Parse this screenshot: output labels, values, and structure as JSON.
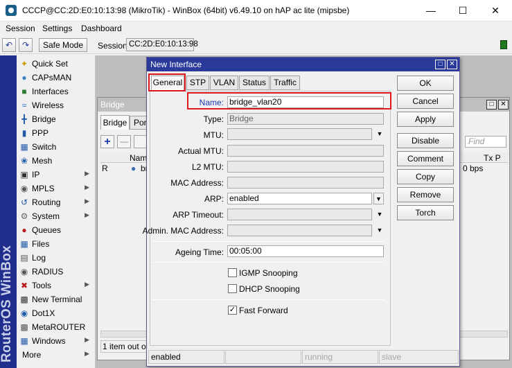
{
  "window": {
    "title": "CCCP@CC:2D:E0:10:13:98 (MikroTik) - WinBox (64bit) v6.49.10 on hAP ac lite (mipsbe)"
  },
  "menu": [
    "Session",
    "Settings",
    "Dashboard"
  ],
  "toolbar": {
    "undo_icon": "undo-arrow",
    "redo_icon": "redo-arrow",
    "safe_mode": "Safe Mode",
    "session_label": "Session:",
    "session_value": "CC:2D:E0:10:13:98",
    "status_indicator_color": "#1f7a1f"
  },
  "brand_text": "RouterOS WinBox",
  "sidebar": {
    "items": [
      {
        "label": "Quick Set",
        "icon": "wand-icon",
        "submenu": false
      },
      {
        "label": "CAPsMAN",
        "icon": "capsman-icon",
        "submenu": false
      },
      {
        "label": "Interfaces",
        "icon": "interfaces-icon",
        "submenu": false
      },
      {
        "label": "Wireless",
        "icon": "wireless-icon",
        "submenu": false
      },
      {
        "label": "Bridge",
        "icon": "bridge-icon",
        "submenu": false
      },
      {
        "label": "PPP",
        "icon": "ppp-icon",
        "submenu": false
      },
      {
        "label": "Switch",
        "icon": "switch-icon",
        "submenu": false
      },
      {
        "label": "Mesh",
        "icon": "mesh-icon",
        "submenu": false
      },
      {
        "label": "IP",
        "icon": "ip-icon",
        "submenu": true
      },
      {
        "label": "MPLS",
        "icon": "mpls-icon",
        "submenu": true
      },
      {
        "label": "Routing",
        "icon": "routing-icon",
        "submenu": true
      },
      {
        "label": "System",
        "icon": "gear-icon",
        "submenu": true
      },
      {
        "label": "Queues",
        "icon": "queues-icon",
        "submenu": false
      },
      {
        "label": "Files",
        "icon": "folder-icon",
        "submenu": false
      },
      {
        "label": "Log",
        "icon": "log-icon",
        "submenu": false
      },
      {
        "label": "RADIUS",
        "icon": "radius-icon",
        "submenu": false
      },
      {
        "label": "Tools",
        "icon": "tools-icon",
        "submenu": true
      },
      {
        "label": "New Terminal",
        "icon": "terminal-icon",
        "submenu": false
      },
      {
        "label": "Dot1X",
        "icon": "dot1x-icon",
        "submenu": false
      },
      {
        "label": "MetaROUTER",
        "icon": "metarouter-icon",
        "submenu": false
      },
      {
        "label": "Windows",
        "icon": "windows-icon",
        "submenu": true
      },
      {
        "label": "More",
        "icon": "",
        "submenu": true
      }
    ]
  },
  "bridge_window": {
    "title": "Bridge",
    "tab_bridge": "Bridge",
    "tab_ports": "Por",
    "find_placeholder": "Find",
    "col_name": "Name",
    "col_tx": "Tx P",
    "row_flag": "R",
    "row_name": "br",
    "row_tx": "0 bps",
    "footer": "1 item out of 1"
  },
  "dialog": {
    "title": "New Interface",
    "tabs": [
      "General",
      "STP",
      "VLAN",
      "Status",
      "Traffic"
    ],
    "fields": {
      "name_label": "Name:",
      "name_value": "bridge_vlan20",
      "type_label": "Type:",
      "type_value": "Bridge",
      "mtu_label": "MTU:",
      "mtu_value": "",
      "actual_mtu_label": "Actual MTU:",
      "actual_mtu_value": "",
      "l2mtu_label": "L2 MTU:",
      "l2mtu_value": "",
      "mac_label": "MAC Address:",
      "mac_value": "",
      "arp_label": "ARP:",
      "arp_value": "enabled",
      "arp_timeout_label": "ARP Timeout:",
      "arp_timeout_value": "",
      "admin_mac_label": "Admin. MAC Address:",
      "admin_mac_value": "",
      "ageing_label": "Ageing Time:",
      "ageing_value": "00:05:00"
    },
    "checkboxes": {
      "igmp": {
        "label": "IGMP Snooping",
        "checked": false
      },
      "dhcp": {
        "label": "DHCP Snooping",
        "checked": false
      },
      "fast_forward": {
        "label": "Fast Forward",
        "checked": true
      }
    },
    "buttons": [
      "OK",
      "Cancel",
      "Apply",
      "Disable",
      "Comment",
      "Copy",
      "Remove",
      "Torch"
    ],
    "status_bar": [
      "enabled",
      "",
      "running",
      "slave"
    ]
  }
}
